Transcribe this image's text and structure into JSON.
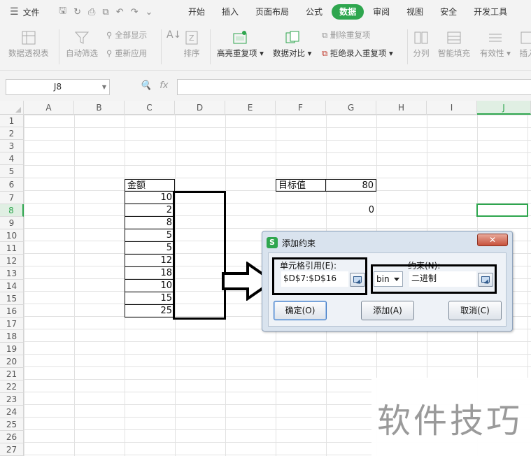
{
  "menubar": {
    "file_label": "文件",
    "tabs": [
      "开始",
      "插入",
      "页面布局",
      "公式",
      "数据",
      "审阅",
      "视图",
      "安全",
      "开发工具"
    ],
    "active_tab": "数据"
  },
  "ribbon": {
    "pivot": "数据透视表",
    "autofilter": "自动筛选",
    "show_all": "全部显示",
    "reapply": "重新应用",
    "sort": "排序",
    "highlight_dup": "高亮重复项",
    "data_compare": "数据对比",
    "remove_dup": "删除重复项",
    "reject_dup": "拒绝录入重复项",
    "split": "分列",
    "smart_fill": "智能填充",
    "validity": "有效性",
    "insert_partial": "插入"
  },
  "formula_bar": {
    "name_box": "J8",
    "fx": "fx"
  },
  "columns": [
    "A",
    "B",
    "C",
    "D",
    "E",
    "F",
    "G",
    "H",
    "I",
    "J"
  ],
  "selected_column": "J",
  "rows": [
    "1",
    "2",
    "3",
    "4",
    "5",
    "6",
    "7",
    "8",
    "9",
    "10",
    "11",
    "12",
    "13",
    "14",
    "15",
    "16",
    "17",
    "18",
    "19",
    "20",
    "21",
    "22",
    "23",
    "24",
    "25",
    "26",
    "27"
  ],
  "selected_row": "8",
  "sheet": {
    "c6": "金额",
    "c_values": [
      "10",
      "2",
      "8",
      "5",
      "5",
      "12",
      "18",
      "10",
      "15",
      "25"
    ],
    "f6": "目标值",
    "g6": "80",
    "g8": "0"
  },
  "dialog": {
    "title": "添加约束",
    "close": "✕",
    "cell_ref_label": "单元格引用(E):",
    "cell_ref_value": "$D$7:$D$16",
    "constraint_label": "约束(N):",
    "operator": "bin",
    "constraint_value": "二进制",
    "ok": "确定(O)",
    "add": "添加(A)",
    "cancel": "取消(C)"
  },
  "watermark": "软件技巧"
}
